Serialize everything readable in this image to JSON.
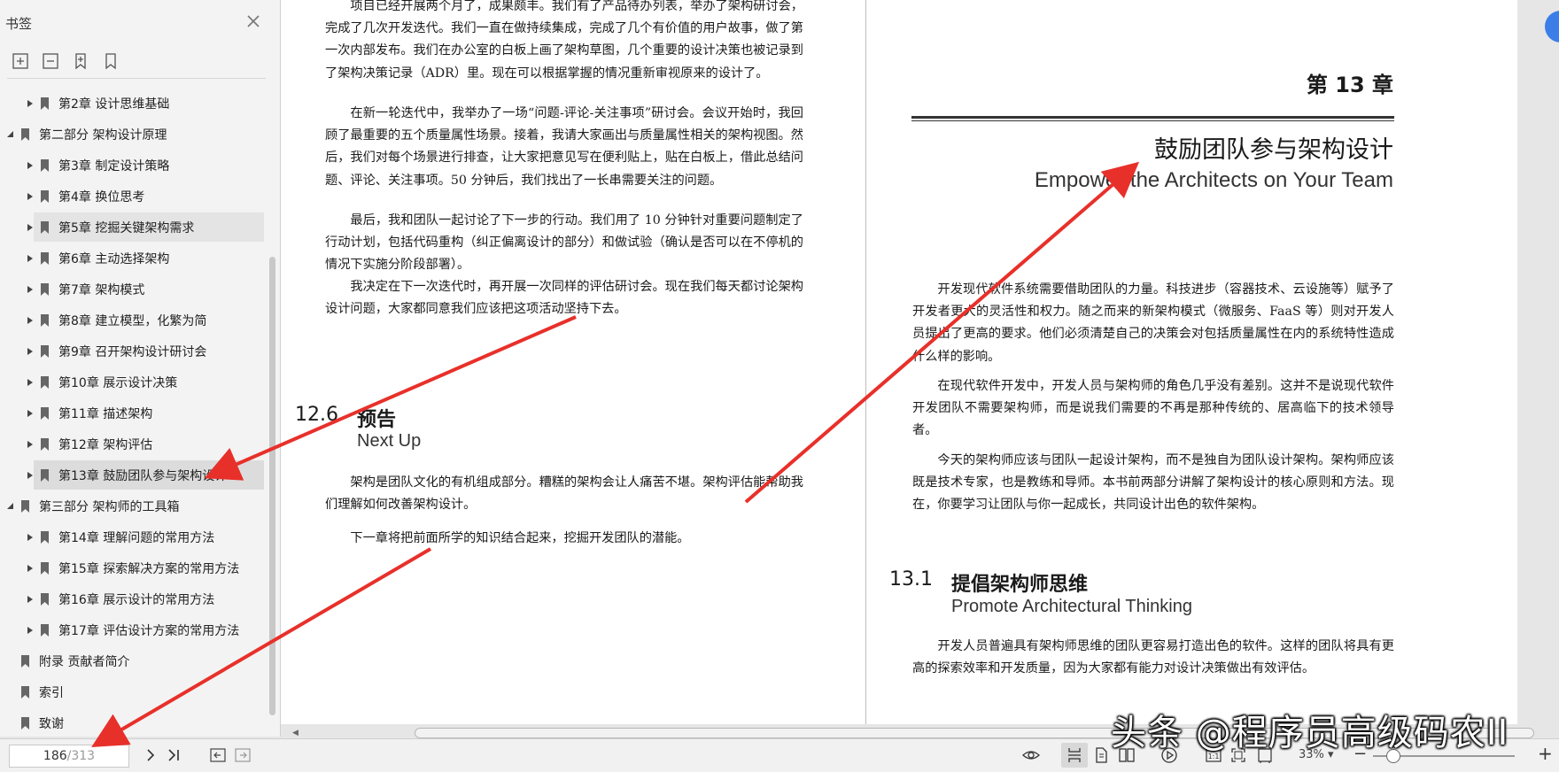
{
  "sidebar": {
    "title": "书签",
    "items": [
      {
        "label": "第2章  设计思维基础",
        "level": 1
      },
      {
        "label": "第二部分  架构设计原理",
        "level": 0,
        "expanded": true
      },
      {
        "label": "第3章  制定设计策略",
        "level": 1
      },
      {
        "label": "第4章  换位思考",
        "level": 1
      },
      {
        "label": "第5章  挖掘关键架构需求",
        "level": 1,
        "state": "hover"
      },
      {
        "label": "第6章  主动选择架构",
        "level": 1
      },
      {
        "label": "第7章  架构模式",
        "level": 1
      },
      {
        "label": "第8章  建立模型，化繁为简",
        "level": 1
      },
      {
        "label": "第9章  召开架构设计研讨会",
        "level": 1
      },
      {
        "label": "第10章  展示设计决策",
        "level": 1
      },
      {
        "label": "第11章  描述架构",
        "level": 1
      },
      {
        "label": "第12章  架构评估",
        "level": 1
      },
      {
        "label": "第13章  鼓励团队参与架构设计",
        "level": 1,
        "state": "selected"
      },
      {
        "label": "第三部分  架构师的工具箱",
        "level": 0,
        "expanded": true
      },
      {
        "label": "第14章  理解问题的常用方法",
        "level": 1
      },
      {
        "label": "第15章  探索解决方案的常用方法",
        "level": 1
      },
      {
        "label": "第16章  展示设计的常用方法",
        "level": 1
      },
      {
        "label": "第17章  评估设计方案的常用方法",
        "level": 1
      },
      {
        "label": "附录  贡献者简介",
        "level": 0,
        "leaf": true
      },
      {
        "label": "索引",
        "level": 0,
        "leaf": true
      },
      {
        "label": "致谢",
        "level": 0,
        "leaf": true
      }
    ]
  },
  "left_page": {
    "para1": "项目已经开展两个月了，成果颇丰。我们有了产品待办列表，举办了架构研讨会，完成了几次开发迭代。我们一直在做持续集成，完成了几个有价值的用户故事，做了第一次内部发布。我们在办公室的白板上画了架构草图，几个重要的设计决策也被记录到了架构决策记录（ADR）里。现在可以根据掌握的情况重新审视原来的设计了。",
    "para2": "在新一轮迭代中，我举办了一场“问题-评论-关注事项”研讨会。会议开始时，我回顾了最重要的五个质量属性场景。接着，我请大家画出与质量属性相关的架构视图。然后，我们对每个场景进行排查，让大家把意见写在便利贴上，贴在白板上，借此总结问题、评论、关注事项。50 分钟后，我们找出了一长串需要关注的问题。",
    "para3": "最后，我和团队一起讨论了下一步的行动。我们用了 10 分钟针对重要问题制定了行动计划，包括代码重构（纠正偏离设计的部分）和做试验（确认是否可以在不停机的情况下实施分阶段部署）。",
    "para4": "我决定在下一次迭代时，再开展一次同样的评估研讨会。现在我们每天都讨论架构设计问题，大家都同意我们应该把这项活动坚持下去。",
    "section_num": "12.6",
    "section_title": "预告",
    "section_en": "Next Up",
    "para5": "架构是团队文化的有机组成部分。糟糕的架构会让人痛苦不堪。架构评估能帮助我们理解如何改善架构设计。",
    "para6": "下一章将把前面所学的知识结合起来，挖掘开发团队的潜能。"
  },
  "right_page": {
    "chapter_label": "第 13 章",
    "chapter_title": "鼓励团队参与架构设计",
    "chapter_en": "Empower the Architects on Your Team",
    "para1": "开发现代软件系统需要借助团队的力量。科技进步（容器技术、云设施等）赋予了开发者更大的灵活性和权力。随之而来的新架构模式（微服务、FaaS 等）则对开发人员提出了更高的要求。他们必须清楚自己的决策会对包括质量属性在内的系统特性造成什么样的影响。",
    "para2": "在现代软件开发中，开发人员与架构师的角色几乎没有差别。这并不是说现代软件开发团队不需要架构师，而是说我们需要的不再是那种传统的、居高临下的技术领导者。",
    "para3": "今天的架构师应该与团队一起设计架构，而不是独自为团队设计架构。架构师应该既是技术专家，也是教练和导师。本书前两部分讲解了架构设计的核心原则和方法。现在，你要学习让团队与你一起成长，共同设计出色的软件架构。",
    "section_num": "13.1",
    "section_title": "提倡架构师思维",
    "section_en": "Promote Architectural Thinking",
    "para4": "开发人员普遍具有架构师思维的团队更容易打造出色的软件。这样的团队将具有更高的探索效率和开发质量，因为大家都有能力对设计决策做出有效评估。"
  },
  "bottombar": {
    "current_page": "186",
    "total_pages": "/313",
    "zoom": "33%",
    "zoom_fraction": 0.14
  },
  "watermark": "头条 @程序员高级码农II",
  "colors": {
    "annotation_arrow": "#e8302a",
    "accent_button": "#3b7ee8"
  }
}
